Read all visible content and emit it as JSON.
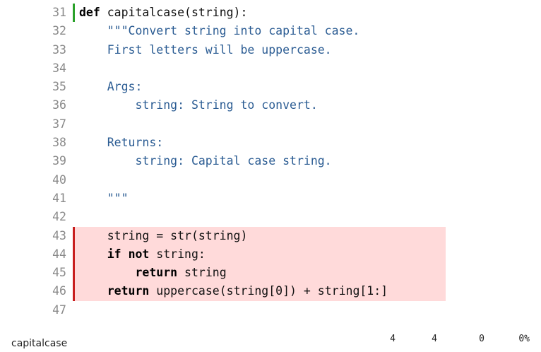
{
  "colors": {
    "executed_marker": "#2aa12a",
    "missed_marker": "#c81e1e",
    "missed_background": "#ffdada",
    "docstring_text": "#2b5c93"
  },
  "lines": [
    {
      "n": "31",
      "status": "run",
      "tokens": [
        {
          "t": "def",
          "k": "kw"
        },
        {
          "t": " capitalcase(string):",
          "k": "plain"
        }
      ]
    },
    {
      "n": "32",
      "status": "",
      "tokens": [
        {
          "t": "    \"\"\"Convert string into capital case.",
          "k": "doc"
        }
      ]
    },
    {
      "n": "33",
      "status": "",
      "tokens": [
        {
          "t": "    First letters will be uppercase.",
          "k": "doc"
        }
      ]
    },
    {
      "n": "34",
      "status": "",
      "tokens": []
    },
    {
      "n": "35",
      "status": "",
      "tokens": [
        {
          "t": "    Args:",
          "k": "doc"
        }
      ]
    },
    {
      "n": "36",
      "status": "",
      "tokens": [
        {
          "t": "        string: String to convert.",
          "k": "doc"
        }
      ]
    },
    {
      "n": "37",
      "status": "",
      "tokens": []
    },
    {
      "n": "38",
      "status": "",
      "tokens": [
        {
          "t": "    Returns:",
          "k": "doc"
        }
      ]
    },
    {
      "n": "39",
      "status": "",
      "tokens": [
        {
          "t": "        string: Capital case string.",
          "k": "doc"
        }
      ]
    },
    {
      "n": "40",
      "status": "",
      "tokens": []
    },
    {
      "n": "41",
      "status": "",
      "tokens": [
        {
          "t": "    \"\"\"",
          "k": "doc"
        }
      ]
    },
    {
      "n": "42",
      "status": "",
      "tokens": []
    },
    {
      "n": "43",
      "status": "miss",
      "tokens": [
        {
          "t": "    string = str(string)",
          "k": "plain"
        }
      ]
    },
    {
      "n": "44",
      "status": "miss",
      "tokens": [
        {
          "t": "    ",
          "k": "plain"
        },
        {
          "t": "if",
          "k": "kw"
        },
        {
          "t": " ",
          "k": "plain"
        },
        {
          "t": "not",
          "k": "kw"
        },
        {
          "t": " string:",
          "k": "plain"
        }
      ]
    },
    {
      "n": "45",
      "status": "miss",
      "tokens": [
        {
          "t": "        ",
          "k": "plain"
        },
        {
          "t": "return",
          "k": "kw"
        },
        {
          "t": " string",
          "k": "plain"
        }
      ]
    },
    {
      "n": "46",
      "status": "miss",
      "tokens": [
        {
          "t": "    ",
          "k": "plain"
        },
        {
          "t": "return",
          "k": "kw"
        },
        {
          "t": " uppercase(string[0]) + string[1:]",
          "k": "plain"
        }
      ]
    },
    {
      "n": "47",
      "status": "",
      "tokens": []
    }
  ],
  "footer": {
    "function_name": "capitalcase",
    "statements": "4",
    "missing": "4",
    "excluded": "0",
    "coverage": "0%"
  }
}
